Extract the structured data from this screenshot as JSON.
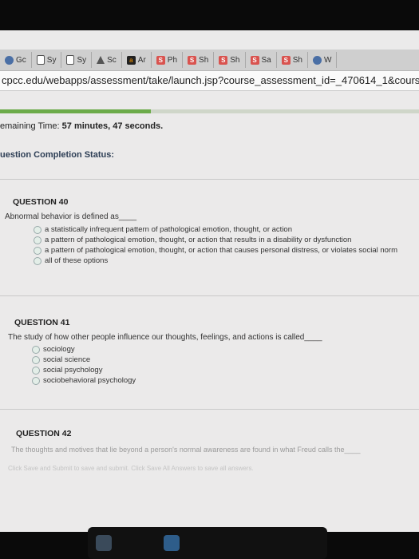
{
  "tabs": [
    {
      "label": "Gc"
    },
    {
      "label": "Sy"
    },
    {
      "label": "Sy"
    },
    {
      "label": "Sc"
    },
    {
      "label": "Ar"
    },
    {
      "label": "Ph"
    },
    {
      "label": "Sh"
    },
    {
      "label": "Sh"
    },
    {
      "label": "Sa"
    },
    {
      "label": "Sh"
    },
    {
      "label": "W"
    }
  ],
  "url": "cpcc.edu/webapps/assessment/take/launch.jsp?course_assessment_id=_470614_1&course_ic",
  "timer": {
    "label": "emaining Time:",
    "value": "57 minutes, 47 seconds."
  },
  "completion_status": "uestion Completion Status:",
  "progress_fraction": 0.36,
  "questions": [
    {
      "heading": "QUESTION 40",
      "text": "Abnormal behavior is defined as____",
      "options": [
        "a statistically infrequent pattern of pathological emotion, thought, or action",
        "a pattern of pathological emotion, thought, or action that results in a disability or dysfunction",
        "a pattern of pathological emotion, thought, or action that causes personal distress, or violates social norm",
        "all of these options"
      ]
    },
    {
      "heading": "QUESTION 41",
      "text": "The study of how other people influence our thoughts, feelings, and actions is called____",
      "options": [
        "sociology",
        "social science",
        "social psychology",
        "sociobehavioral psychology"
      ]
    },
    {
      "heading": "QUESTION 42",
      "text": "The thoughts and motives that lie beyond a person's normal awareness are found in what Freud calls the____",
      "options": []
    }
  ],
  "footer_text": "Click Save and Submit to save and submit. Click Save All Answers to save all answers."
}
